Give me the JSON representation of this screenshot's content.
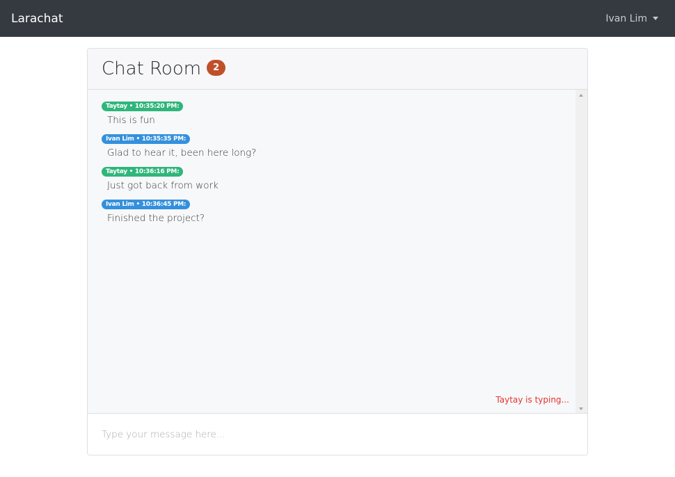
{
  "nav": {
    "brand": "Larachat",
    "user": "Ivan Lim"
  },
  "chat": {
    "title": "Chat Room",
    "count": "2",
    "typing": "Taytay is typing...",
    "placeholder": "Type your message here...",
    "messages": [
      {
        "tag": "Taytay • 10:35:20 PM:",
        "text": "This is fun",
        "color": "#2fb67a"
      },
      {
        "tag": "Ivan Lim • 10:35:35 PM:",
        "text": "Glad to hear it, been here long?",
        "color": "#3490dc"
      },
      {
        "tag": "Taytay • 10:36:16 PM:",
        "text": "Just got back from work",
        "color": "#2fb67a"
      },
      {
        "tag": "Ivan Lim • 10:36:45 PM:",
        "text": "Finished the project?",
        "color": "#3490dc"
      }
    ]
  }
}
